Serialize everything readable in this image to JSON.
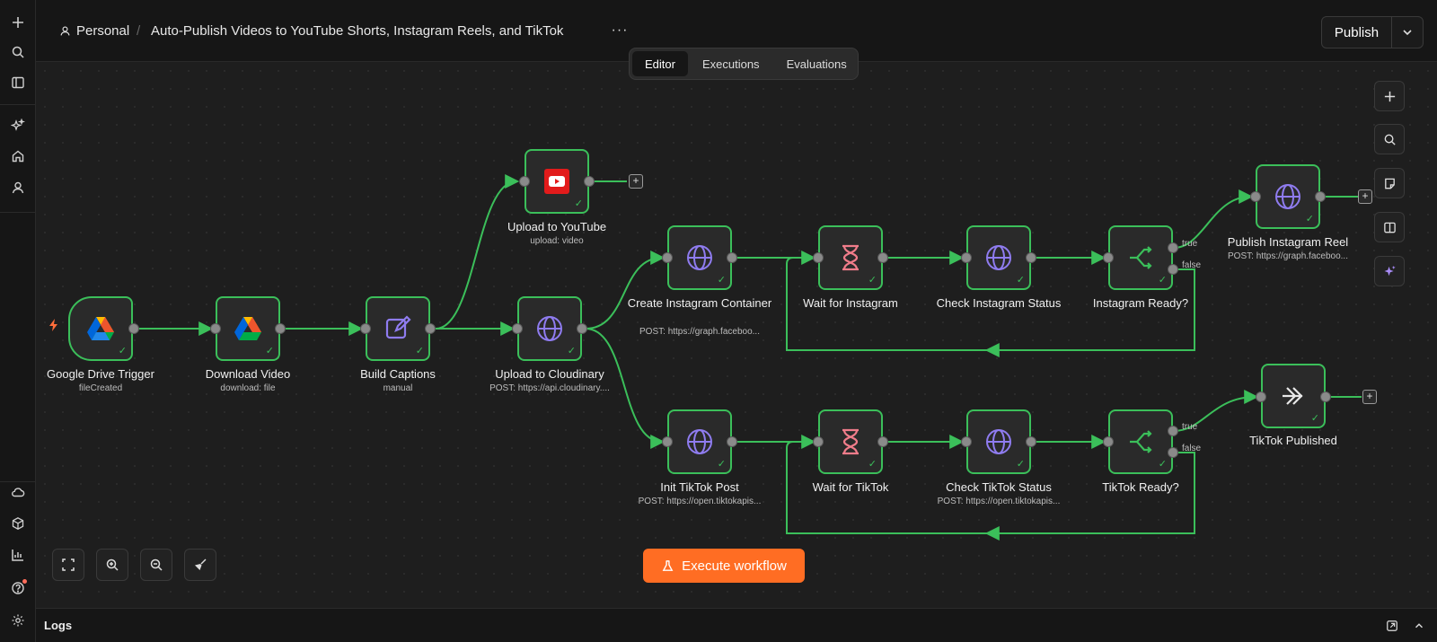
{
  "header": {
    "project": "Personal",
    "workflow_title": "Auto-Publish Videos to YouTube Shorts, Instagram Reels, and TikTok",
    "more": "···",
    "publish_label": "Publish"
  },
  "tabs": [
    {
      "label": "Editor",
      "active": true
    },
    {
      "label": "Executions",
      "active": false
    },
    {
      "label": "Evaluations",
      "active": false
    }
  ],
  "nodes": {
    "gdrive_trigger": {
      "label": "Google Drive Trigger",
      "sub": "fileCreated",
      "icon": "google-drive-icon"
    },
    "download_video": {
      "label": "Download Video",
      "sub": "download: file",
      "icon": "google-drive-icon"
    },
    "build_captions": {
      "label": "Build Captions",
      "sub": "manual",
      "icon": "edit-icon"
    },
    "upload_cloudinary": {
      "label": "Upload to Cloudinary",
      "sub": "POST: https://api.cloudinary....",
      "icon": "globe-icon"
    },
    "upload_youtube": {
      "label": "Upload to YouTube",
      "sub": "upload: video",
      "icon": "youtube-icon"
    },
    "create_ig_container": {
      "label": "Create Instagram Container",
      "sub": "POST: https://graph.faceboo...",
      "icon": "globe-icon"
    },
    "wait_instagram": {
      "label": "Wait for Instagram",
      "sub": "",
      "icon": "hourglass-icon"
    },
    "check_ig_status": {
      "label": "Check Instagram Status",
      "sub": "",
      "icon": "globe-icon"
    },
    "ig_ready": {
      "label": "Instagram Ready?",
      "sub": "",
      "icon": "if-branch-icon"
    },
    "publish_ig_reel": {
      "label": "Publish Instagram Reel",
      "sub": "POST: https://graph.faceboo...",
      "icon": "globe-icon"
    },
    "init_tiktok": {
      "label": "Init TikTok Post",
      "sub": "POST: https://open.tiktokapis...",
      "icon": "globe-icon"
    },
    "wait_tiktok": {
      "label": "Wait for TikTok",
      "sub": "",
      "icon": "hourglass-icon"
    },
    "check_tiktok_status": {
      "label": "Check TikTok Status",
      "sub": "POST: https://open.tiktokapis...",
      "icon": "globe-icon"
    },
    "tiktok_ready": {
      "label": "TikTok Ready?",
      "sub": "",
      "icon": "if-branch-icon"
    },
    "tiktok_published": {
      "label": "TikTok Published",
      "sub": "",
      "icon": "no-op-arrow-icon"
    }
  },
  "branch_labels": {
    "true": "true",
    "false": "false"
  },
  "execute_label": "Execute workflow",
  "logs_label": "Logs",
  "colors": {
    "accent": "#ff6d23",
    "success": "#3bbf5a",
    "node_bg": "#2a2a2a",
    "canvas": "#1e1e1e"
  }
}
